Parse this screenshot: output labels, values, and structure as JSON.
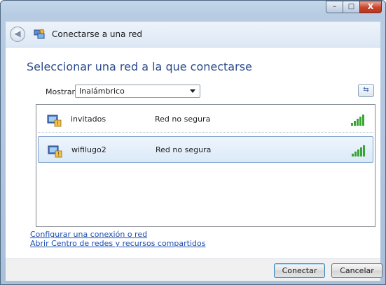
{
  "window": {
    "title": "Conectarse a una red",
    "controls": {
      "minimize": "–",
      "maximize": "□",
      "close": "X"
    }
  },
  "page": {
    "heading": "Seleccionar una red a la que conectarse"
  },
  "filter": {
    "label": "Mostrar",
    "selected": "Inalámbrico"
  },
  "refresh": {
    "glyph": "⇆"
  },
  "networks": [
    {
      "name": "invitados",
      "security": "Red no segura",
      "signal_bars": 5,
      "selected": false
    },
    {
      "name": "wifilugo2",
      "security": "Red no segura",
      "signal_bars": 5,
      "selected": true
    }
  ],
  "links": [
    "Configurar una conexión o red",
    "Abrir Centro de redes y recursos compartidos"
  ],
  "buttons": {
    "connect": "Conectar",
    "cancel": "Cancelar"
  },
  "colors": {
    "heading": "#2c4c8c",
    "link": "#1c4fae",
    "signal": "#3aa534",
    "selection": "#dbe9f8"
  }
}
